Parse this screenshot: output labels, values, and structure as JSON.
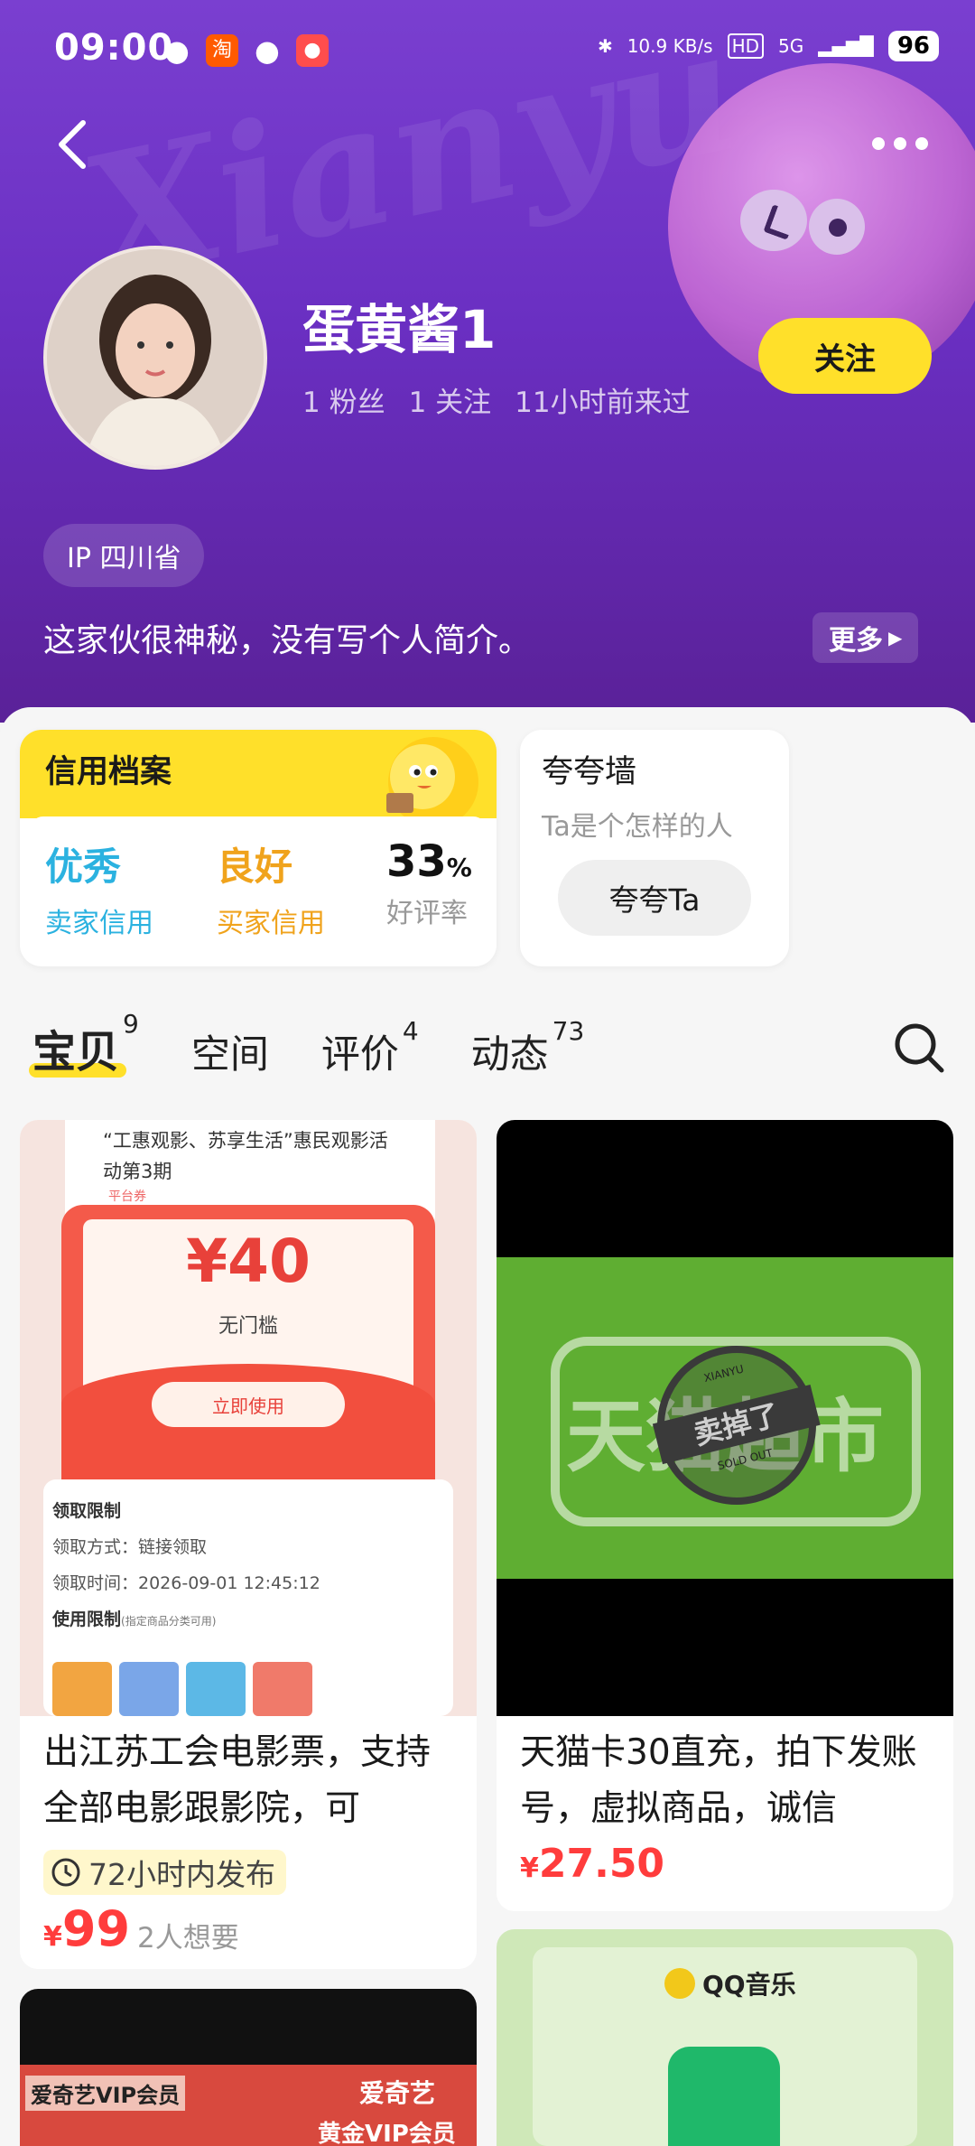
{
  "status_bar": {
    "time": "09:00",
    "net_speed": "10.9 KB/s",
    "hd": "HD",
    "signal": "5G",
    "battery": "96"
  },
  "profile": {
    "username": "蛋黄酱1",
    "fans": "1 粉丝",
    "following": "1 关注",
    "last_seen": "11小时前来过",
    "follow_label": "关注",
    "ip": "IP 四川省",
    "bio": "这家伙很神秘，没有写个人简介。",
    "more_label": "更多"
  },
  "credit": {
    "title": "信用档案",
    "seller_value": "优秀",
    "seller_label": "卖家信用",
    "buyer_value": "良好",
    "buyer_label": "买家信用",
    "rating_value": "33",
    "rating_unit": "%",
    "rating_label": "好评率",
    "seller_color": "#2bb2e0",
    "buyer_color": "#f0a31c"
  },
  "praise": {
    "title": "夸夸墙",
    "subtitle": "Ta是个怎样的人",
    "button": "夸夸Ta"
  },
  "tabs": [
    {
      "label": "宝贝",
      "count": "9"
    },
    {
      "label": "空间",
      "count": ""
    },
    {
      "label": "评价",
      "count": "4"
    },
    {
      "label": "动态",
      "count": "73"
    }
  ],
  "products": [
    {
      "title": "出江苏工会电影票，支持全部电影跟影院，可",
      "tag": "72小时内发布",
      "currency": "¥",
      "price": "99",
      "wants": "2人想要",
      "image": {
        "headline": "“工惠观影、苏享生活”惠民观影活动第3期",
        "platform": "平台券",
        "amount": "¥40",
        "threshold": "无门槛",
        "use_btn": "立即使用",
        "rule_title": "领取限制",
        "rule_method": "领取方式：链接领取",
        "rule_time": "领取时间：2026-09-01 12:45:12",
        "use_title": "使用限制",
        "use_note": "(指定商品分类可用)"
      }
    },
    {
      "title": "天猫卡30直充，拍下发账号，虚拟商品，诚信",
      "currency": "¥",
      "price": "27.50",
      "image": {
        "text": "天猫超市",
        "stamp_top": "XIANYU",
        "stamp": "卖掉了",
        "stamp_bottom": "SOLD OUT"
      }
    },
    {
      "image": {
        "brand": "爱奇艺VIP会员",
        "brand2": "爱奇艺",
        "brand3": "黄金VIP会员"
      }
    },
    {
      "image": {
        "brand": "QQ音乐"
      }
    }
  ],
  "colors": {
    "header": "#6a2fc2",
    "accent_yellow": "#ffe02a",
    "price_red": "#ff3c3c"
  },
  "watermark": "Xianyu"
}
